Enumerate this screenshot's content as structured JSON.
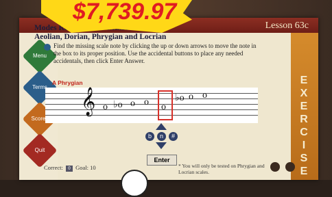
{
  "price": "$7,739.97",
  "lesson": "Lesson 63c",
  "title_line1": "Modes Related to the Minor Scale:",
  "title_line2": "Aeolian, Dorian, Phrygian and Locrian",
  "instruction": "Find the missing scale note by clicking the up or down arrows to move the note in the box to its proper position. Use the accidental buttons to place any needed accidentals, then click Enter Answer.",
  "scale_label": "A Phrygian",
  "nav": {
    "menu": "Menu",
    "terms": "Terms",
    "scores": "Scores",
    "quit": "Quit"
  },
  "sidebar_right": "EXERCISE",
  "enter_label": "Enter",
  "correct_label": "Correct:",
  "correct_value": "0",
  "goal_label": "Goal: 10",
  "note": "* You will only be tested on Phrygian and Locrian scales.",
  "accidentals": [
    "b",
    "n",
    "#"
  ],
  "colors": {
    "accent": "#8c2e22",
    "exercise": "#c9791f",
    "price": "#e01b22",
    "badge": "#ffd817"
  }
}
